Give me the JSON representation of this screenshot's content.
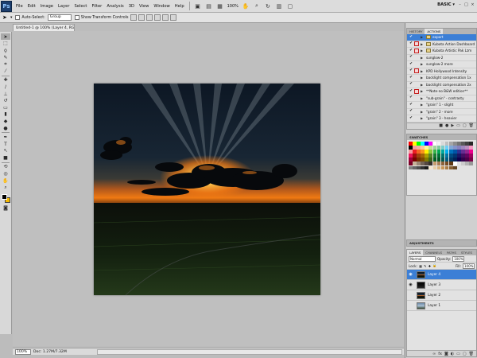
{
  "menubar": {
    "logo": "Ps",
    "items": [
      "File",
      "Edit",
      "Image",
      "Layer",
      "Select",
      "Filter",
      "Analysis",
      "3D",
      "View",
      "Window",
      "Help"
    ],
    "zoom": "100%",
    "workspace": "BASIC ▾"
  },
  "options": {
    "auto_select_label": "Auto-Select:",
    "auto_select_value": "Group",
    "show_transform_label": "Show Transform Controls"
  },
  "document": {
    "tab_title": "Untitled-1 @ 100% (Layer 4, RGB/8) *"
  },
  "status": {
    "zoom": "100%",
    "doc_info": "Doc: 1.27M/7.32M"
  },
  "actions_panel": {
    "tabs": [
      "HISTORY",
      "ACTIONS"
    ],
    "rows": [
      {
        "check": "✔",
        "dialog": false,
        "folder": true,
        "label": "export",
        "selected": true
      },
      {
        "check": "✔",
        "dialog": true,
        "folder": true,
        "label": "Kubota Action Dashboard",
        "selected": false
      },
      {
        "check": "✔",
        "dialog": true,
        "folder": true,
        "label": "Kubota Artistic Pak Lzm",
        "selected": false
      },
      {
        "check": "✔",
        "dialog": false,
        "folder": false,
        "label": "sunglow-2",
        "selected": false
      },
      {
        "check": "✔",
        "dialog": false,
        "folder": false,
        "label": "sunglow-2 more",
        "selected": false
      },
      {
        "check": "✔",
        "dialog": true,
        "folder": false,
        "label": "KPD Hollywood Intensity",
        "selected": false
      },
      {
        "check": "✔",
        "dialog": false,
        "folder": false,
        "label": "backlight compensation 1x",
        "selected": false
      },
      {
        "check": "✔",
        "dialog": false,
        "folder": false,
        "label": "backlight compensation 2x",
        "selected": false
      },
      {
        "check": "✔",
        "dialog": true,
        "folder": false,
        "label": "**Note-no B&W edition**",
        "selected": false
      },
      {
        "check": "✔",
        "dialog": false,
        "folder": false,
        "label": "\"sub-grain\" - contrasty",
        "selected": false
      },
      {
        "check": "✔",
        "dialog": false,
        "folder": false,
        "label": "\"grain\" 1 - slight",
        "selected": false
      },
      {
        "check": "✔",
        "dialog": false,
        "folder": false,
        "label": "\"grain\" 2 - more",
        "selected": false
      },
      {
        "check": "✔",
        "dialog": false,
        "folder": false,
        "label": "\"grain\" 3 - heavier",
        "selected": false
      }
    ]
  },
  "swatches_panel": {
    "title": "SWATCHES",
    "colors": [
      "#ff0000",
      "#ffff00",
      "#00ff00",
      "#00ffff",
      "#0000ff",
      "#ff00ff",
      "#ffffff",
      "#f2f2f2",
      "#d9d9d9",
      "#bfbfbf",
      "#a6a6a6",
      "#8c8c8c",
      "#737373",
      "#595959",
      "#404040",
      "#262626",
      "#000000",
      "#f79d9d",
      "#f7ad9d",
      "#f9c79b",
      "#fff799",
      "#c4df9b",
      "#a2d39c",
      "#82ca9d",
      "#7bcdc8",
      "#6ecff6",
      "#7ea7d8",
      "#8493ca",
      "#8882be",
      "#a187be",
      "#bc8dbf",
      "#f49ac2",
      "#f6989d",
      "#ed1c24",
      "#f26522",
      "#f7941d",
      "#fff200",
      "#8dc73f",
      "#39b54a",
      "#00a651",
      "#00a99d",
      "#00aeef",
      "#0072bc",
      "#0054a6",
      "#2e3192",
      "#662d91",
      "#92278f",
      "#ec008c",
      "#ed145b",
      "#9e0b0f",
      "#a0410d",
      "#a36209",
      "#aba000",
      "#598527",
      "#1a7b30",
      "#007236",
      "#00746b",
      "#0076a3",
      "#004a80",
      "#003471",
      "#1b1464",
      "#440e62",
      "#630460",
      "#9e005d",
      "#9e0039",
      "#790000",
      "#7b2e00",
      "#7d4900",
      "#827b00",
      "#406618",
      "#005e20",
      "#005826",
      "#005952",
      "#005b7f",
      "#003663",
      "#002157",
      "#0d004c",
      "#32004b",
      "#4b0049",
      "#7b0046",
      "#7a0026",
      "#c7b299",
      "#998675",
      "#736357",
      "#534741",
      "#37302a",
      "#c69c6d",
      "#a67c52",
      "#8c6239",
      "#754c24",
      "#603913",
      "#ffffff",
      "#e0e0e0",
      "#cccccc",
      "#b3b3b3",
      "#999999",
      "#808080",
      "#666666",
      "#4d4d4d",
      "#333333",
      "#1a1a1a",
      "#f5e6cf",
      "#e8cfa6",
      "#d9b27c",
      "#c89656",
      "#a97b44",
      "#876033",
      "#654624"
    ]
  },
  "adjust_panel": {
    "title": "ADJUSTMENTS"
  },
  "layers_panel": {
    "tabs": [
      "LAYERS",
      "CHANNELS",
      "PATHS",
      "STYLES"
    ],
    "blend_mode": "Normal",
    "opacity_label": "Opacity:",
    "opacity": "100%",
    "lock_label": "Lock:",
    "fill_label": "Fill:",
    "fill": "100%",
    "layers": [
      {
        "name": "Layer 4",
        "visible": true,
        "selected": true,
        "thumb": "sunset"
      },
      {
        "name": "Layer 3",
        "visible": true,
        "selected": false,
        "thumb": "dark"
      },
      {
        "name": "Layer 2",
        "visible": false,
        "selected": false,
        "thumb": "sunset"
      },
      {
        "name": "Layer 1",
        "visible": false,
        "selected": false,
        "thumb": "sky"
      }
    ]
  },
  "colors": {
    "selection": "#3c7fd6",
    "background_color": "#f4b800",
    "foreground_color": "#000000"
  }
}
